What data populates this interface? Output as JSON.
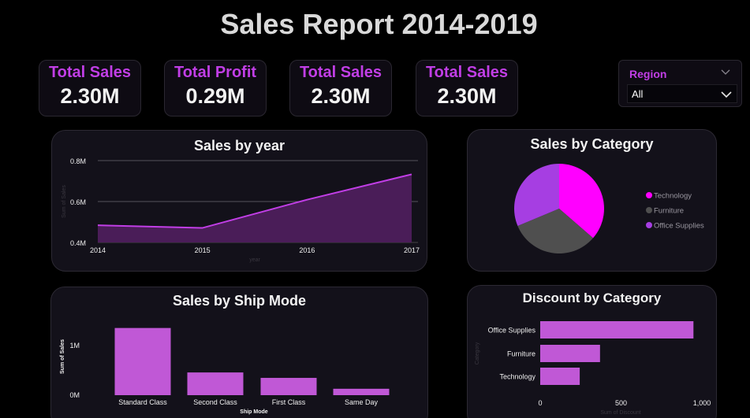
{
  "report": {
    "title": "Sales Report 2014-2019"
  },
  "kpis": [
    {
      "label": "Total Sales",
      "value": "2.30M"
    },
    {
      "label": "Total Profit",
      "value": "0.29M"
    },
    {
      "label": "Total Sales",
      "value": "2.30M"
    },
    {
      "label": "Total Sales",
      "value": "2.30M"
    }
  ],
  "region_slicer": {
    "label": "Region",
    "selected": "All"
  },
  "colors": {
    "accent": "#c13ee6",
    "bar": "#c058d6",
    "technology": "#ff00ff",
    "furniture": "#4f4f4f",
    "office_supplies": "#a63ee2"
  },
  "chart_data": [
    {
      "type": "area",
      "title": "Sales by year",
      "xlabel": "year",
      "ylabel": "Sum of Sales",
      "x": [
        "2014",
        "2015",
        "2016",
        "2017"
      ],
      "values": [
        0.484,
        0.471,
        0.609,
        0.733
      ],
      "yticks": [
        "0.4M",
        "0.6M",
        "0.8M"
      ],
      "ylim": [
        0.4,
        0.8
      ],
      "grid": true
    },
    {
      "type": "pie",
      "title": "Sales by Category",
      "categories": [
        "Technology",
        "Furniture",
        "Office Supplies"
      ],
      "values": [
        0.836,
        0.742,
        0.719
      ],
      "legend": "right"
    },
    {
      "type": "bar",
      "title": "Sales by Ship Mode",
      "xlabel": "Ship Mode",
      "ylabel": "Sum of Sales",
      "categories": [
        "Standard Class",
        "Second Class",
        "First Class",
        "Same Day"
      ],
      "values": [
        1.36,
        0.46,
        0.35,
        0.13
      ],
      "yticks": [
        "0M",
        "1M"
      ],
      "ylim": [
        0,
        1.45
      ]
    },
    {
      "type": "bar",
      "orientation": "horizontal",
      "title": "Discount by Category",
      "xlabel": "Sum of Discount",
      "ylabel": "Category",
      "categories": [
        "Office Supplies",
        "Furniture",
        "Technology"
      ],
      "values": [
        947.8,
        369.9,
        244.4
      ],
      "xticks": [
        "0",
        "500",
        "1,000"
      ],
      "xlim": [
        0,
        1000
      ]
    }
  ]
}
